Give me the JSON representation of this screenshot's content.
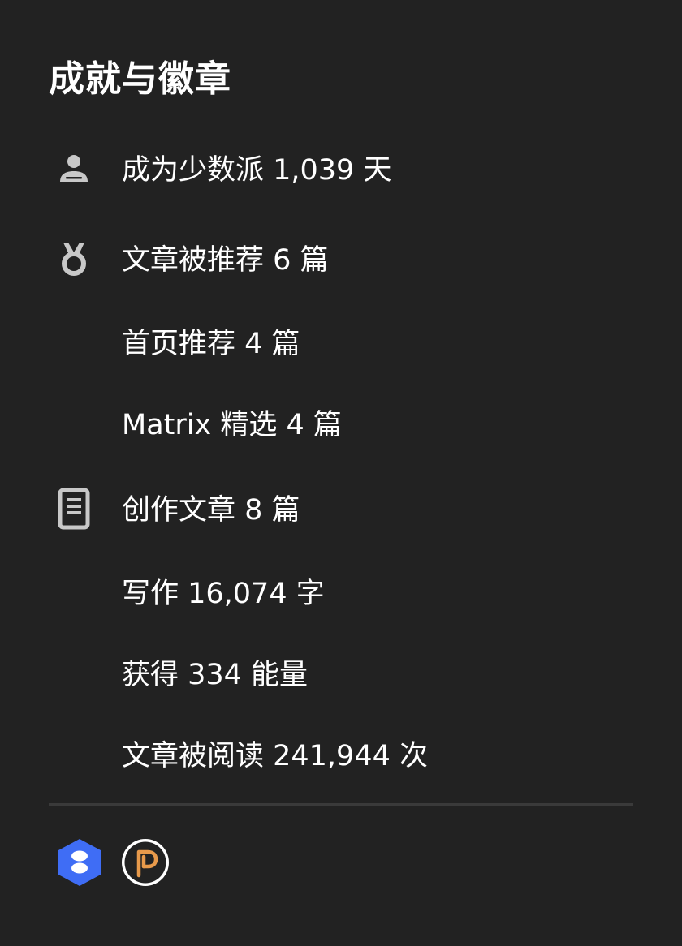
{
  "section": {
    "title": "成就与徽章"
  },
  "stats": {
    "minority_days": "成为少数派 1,039 天",
    "recommended": "文章被推荐 6 篇",
    "homepage": "首页推荐 4 篇",
    "matrix": "Matrix 精选 4 篇",
    "articles": "创作文章 8 篇",
    "words": "写作 16,074 字",
    "energy": "获得 334 能量",
    "reads": "文章被阅读 241,944 次"
  },
  "icons": {
    "user": "user-icon",
    "medal": "medal-icon",
    "document": "document-icon"
  },
  "badges": [
    {
      "name": "blue-hexagon-badge",
      "color": "#3f6df5"
    },
    {
      "name": "p-circle-badge",
      "color": "#e89a4b"
    }
  ],
  "colors": {
    "background": "#222222",
    "text": "#ffffff",
    "icon": "#c8c8c8"
  }
}
